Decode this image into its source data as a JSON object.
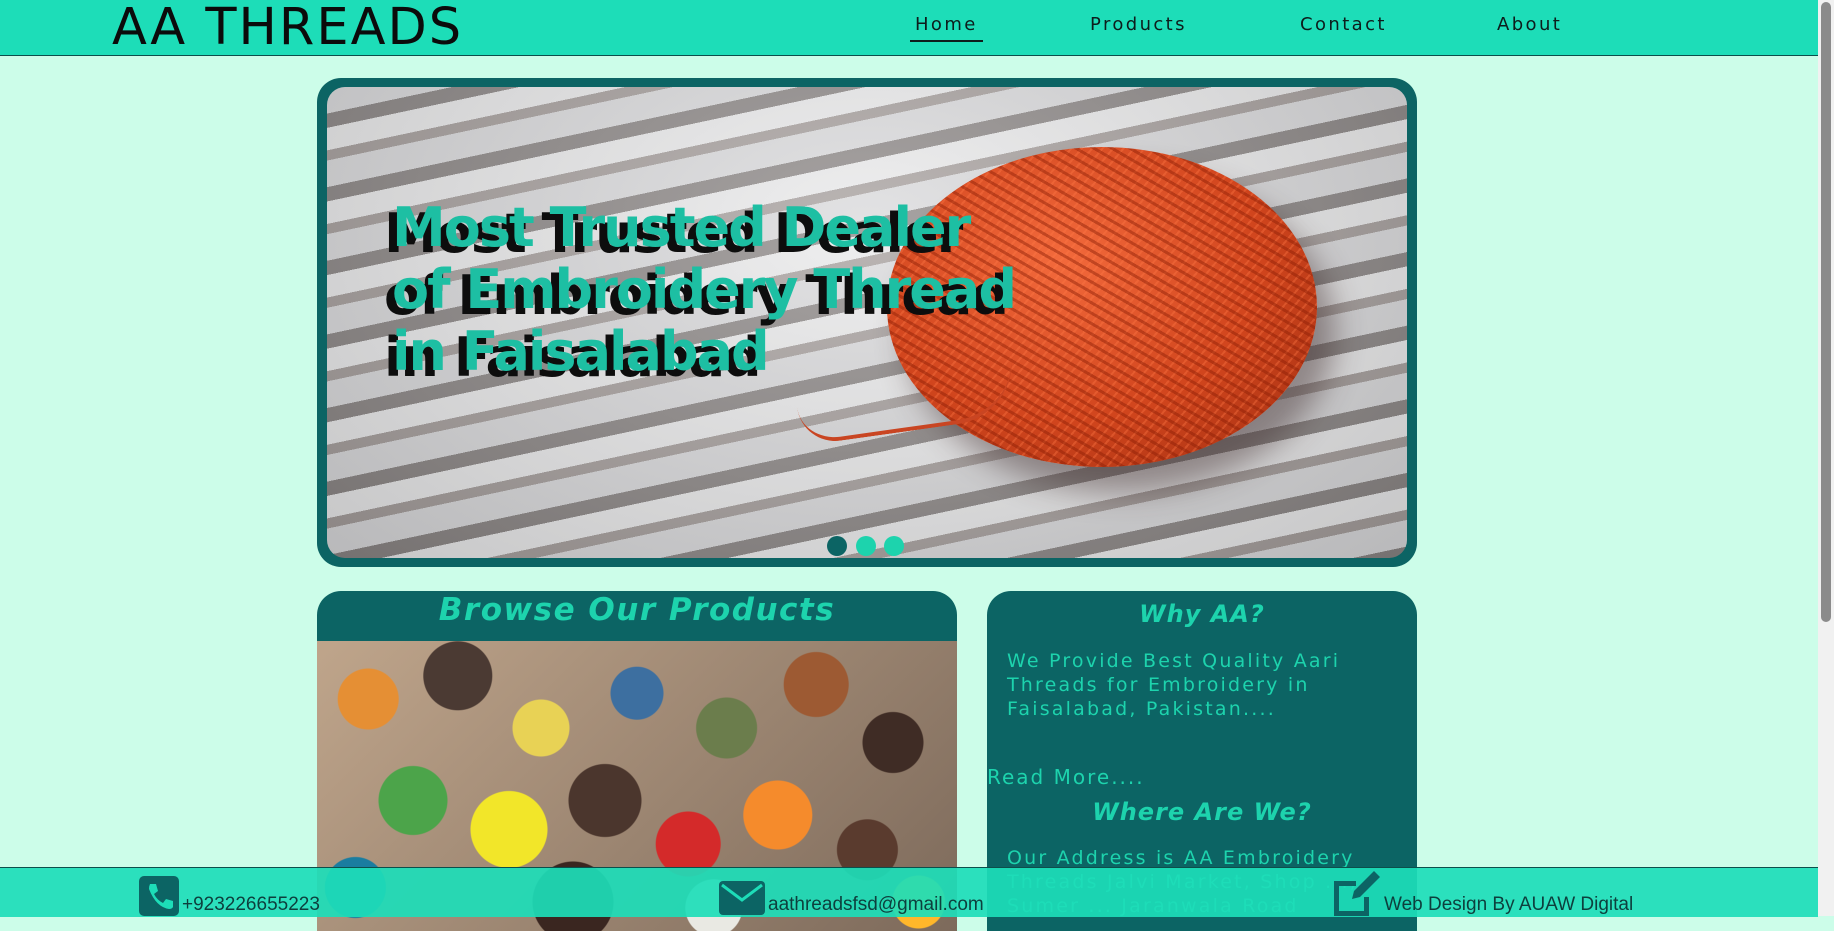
{
  "header": {
    "brand": "AA THREADS",
    "nav": [
      {
        "label": "Home",
        "active": true
      },
      {
        "label": "Products",
        "active": false
      },
      {
        "label": "Contact",
        "active": false
      },
      {
        "label": "About",
        "active": false
      }
    ]
  },
  "hero": {
    "headline": "Most Trusted Dealer\nof Embroidery Thread\nin Faisalabad",
    "dots": 3,
    "active_dot": 1
  },
  "products": {
    "title": "Browse Our Products"
  },
  "why": {
    "title": "Why AA?",
    "text": "We Provide Best Quality Aari Threads for Embroidery in Faisalabad, Pakistan....",
    "read_more": "Read More...."
  },
  "where": {
    "title": "Where Are We?",
    "text": "Our Address is AA Embroidery Threads Jalvi Market, Shop ..., Sumer ... Jaranwala Road"
  },
  "footer": {
    "phone": "+923226655223",
    "email": "aathreadsfsd@gmail.com",
    "credit": "Web Design By AUAW Digital"
  },
  "colors": {
    "header_bg": "#1dddb8",
    "page_bg": "#ccfde9",
    "card_bg": "#0c6464",
    "accent": "#1dd3ad"
  }
}
